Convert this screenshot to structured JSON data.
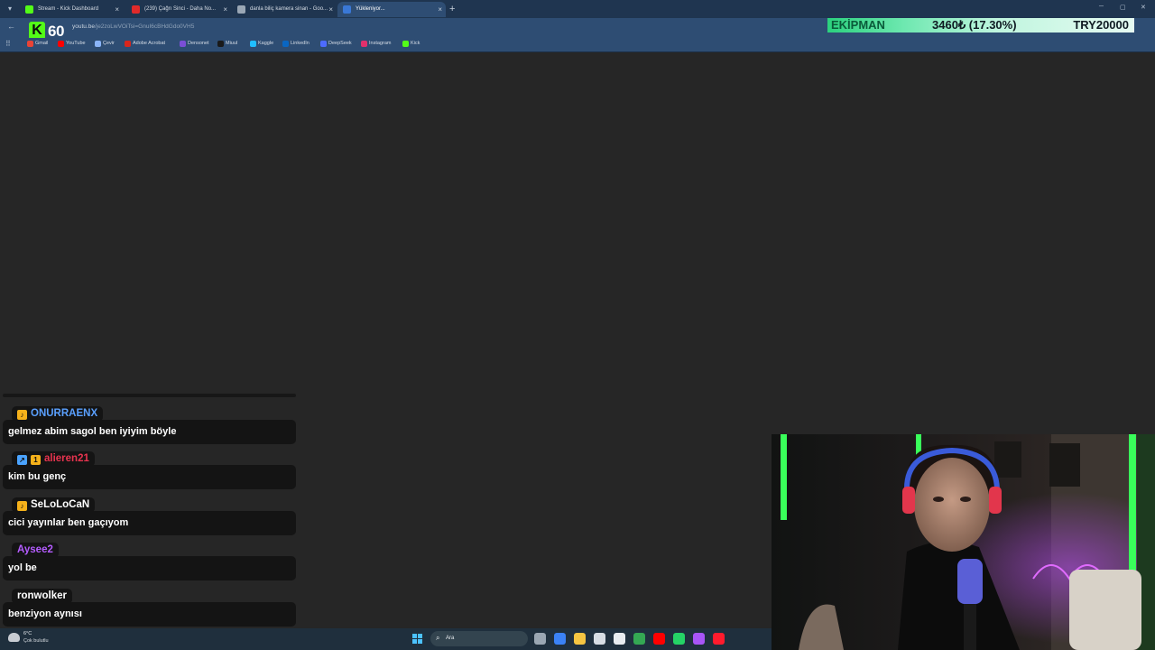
{
  "browser": {
    "tabs": [
      {
        "title": "Stream - Kick Dashboard",
        "favicon_color": "#53fc18",
        "active": false
      },
      {
        "title": "(239) Çağrı Sinci - Daha No...",
        "favicon_color": "#e02a2a",
        "active": false
      },
      {
        "title": "danla biliç kamera sinan - Goo...",
        "favicon_color": "#9aa7b5",
        "active": false
      },
      {
        "title": "Yükleniyor...",
        "favicon_color": "#3a78d6",
        "active": true
      }
    ],
    "new_tab_glyph": "+",
    "close_glyph": "×",
    "window_controls": [
      "─",
      "▢",
      "✕"
    ],
    "url": {
      "host": "youtu.be",
      "path": "/je2zoLwVOiTsi=GnuI6cBHdGdo0VH5"
    },
    "bookmarks": [
      {
        "label": "Gmail",
        "color": "#ea4335"
      },
      {
        "label": "YouTube",
        "color": "#ff0000"
      },
      {
        "label": "Çevir",
        "color": "#8ab4f8"
      },
      {
        "label": "Adobe Acrobat",
        "color": "#d9261c"
      },
      {
        "label": "Densonet",
        "color": "#7b4fd6"
      },
      {
        "label": "Miuul",
        "color": "#1a1a1a"
      },
      {
        "label": "Kaggle",
        "color": "#20beff"
      },
      {
        "label": "LinkedIn",
        "color": "#0a66c2"
      },
      {
        "label": "DeepSeek",
        "color": "#4d6bfe"
      },
      {
        "label": "Instagram",
        "color": "#e1306c"
      },
      {
        "label": "Kick",
        "color": "#53fc18"
      }
    ]
  },
  "overlay": {
    "kick_logo": "K",
    "viewer_count": "60",
    "donation": {
      "label": "EKİPMAN",
      "progress_text": "3460₺ (17.30%)",
      "goal": "TRY20000",
      "progress": 0.173
    }
  },
  "chat": {
    "messages": [
      {
        "user": "ONURRAENX",
        "user_color": "#5aa0ff",
        "badges": [
          {
            "glyph": "♪",
            "color": "#f5b11a"
          }
        ],
        "text": "gelmez abim sagol ben iyiyim böyle"
      },
      {
        "user": "alieren21",
        "user_color": "#e8344f",
        "badges": [
          {
            "glyph": "↗",
            "color": "#4aa3ff"
          },
          {
            "glyph": "1",
            "color": "#f5b11a"
          }
        ],
        "text": "kim bu genç"
      },
      {
        "user": "SeLoLoCaN",
        "user_color": "#ffffff",
        "badges": [
          {
            "glyph": "♪",
            "color": "#f5b11a"
          }
        ],
        "text": "cici yayınlar ben gaçıyom"
      },
      {
        "user": "Aysee2",
        "user_color": "#b45cff",
        "badges": [],
        "text": "yol be"
      },
      {
        "user": "ronwolker",
        "user_color": "#ffffff",
        "badges": [],
        "text": "benziyon aynısı"
      }
    ]
  },
  "taskbar": {
    "weather_temp": "6°C",
    "weather_desc": "Çok bulutlu",
    "search_placeholder": "Ara",
    "search_glyph": "⌕",
    "apps": [
      {
        "name": "task-view",
        "color": "#9aa6b2"
      },
      {
        "name": "copilot",
        "color": "#3b82f6"
      },
      {
        "name": "file-explorer",
        "color": "#f5c542"
      },
      {
        "name": "store",
        "color": "#d7dde4"
      },
      {
        "name": "app-s",
        "color": "#e8ecf0"
      },
      {
        "name": "chrome",
        "color": "#34a853"
      },
      {
        "name": "youtube-music",
        "color": "#ff0000"
      },
      {
        "name": "whatsapp",
        "color": "#25d366"
      },
      {
        "name": "messenger",
        "color": "#a855f7"
      },
      {
        "name": "opera",
        "color": "#ff1b2d"
      }
    ]
  }
}
